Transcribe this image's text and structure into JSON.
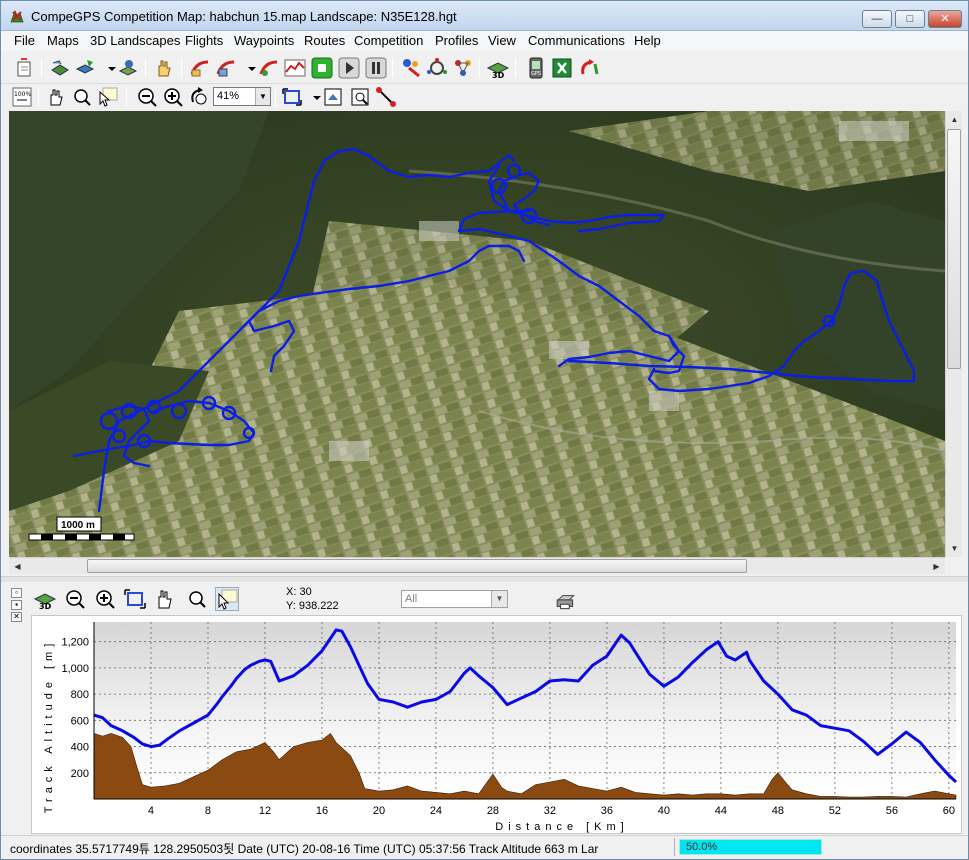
{
  "window": {
    "title": "CompeGPS Competition Map: habchun 15.map Landscape: N35E128.hgt",
    "buttons": {
      "minimize": "—",
      "maximize": "□",
      "close": "✕"
    }
  },
  "menu": [
    {
      "label": "File"
    },
    {
      "label": "Maps"
    },
    {
      "label": "3D Landscapes"
    },
    {
      "label": "Flights"
    },
    {
      "label": "Waypoints"
    },
    {
      "label": "Routes"
    },
    {
      "label": "Competition"
    },
    {
      "label": "Profiles"
    },
    {
      "label": "View"
    },
    {
      "label": "Communications"
    },
    {
      "label": "Help"
    }
  ],
  "toolbar2": {
    "zoom_value": "41%",
    "zoom_icon_label": "100%"
  },
  "map": {
    "scale_label": "1000 m",
    "track_color": "#0a1ee6"
  },
  "profile": {
    "cursor_x": "X: 30",
    "cursor_y": "Y: 938.222",
    "layer_filter": "All",
    "panel_controls": {
      "restore": "▫",
      "menu": "▪",
      "close": "✕"
    }
  },
  "chart_data": {
    "type": "area",
    "xlabel": "Distance [Km]",
    "ylabel": "Track Altitude [m]",
    "x_ticks": [
      4,
      8,
      12,
      16,
      20,
      24,
      28,
      32,
      36,
      40,
      44,
      48,
      52,
      56,
      60
    ],
    "y_ticks": [
      200,
      400,
      600,
      800,
      "1,000",
      "1,200"
    ],
    "xlim": [
      0,
      60.5
    ],
    "ylim": [
      0,
      1350
    ],
    "grid": true,
    "series": [
      {
        "kind": "line",
        "color": "#0a0ae6",
        "points": [
          [
            0,
            640
          ],
          [
            0.6,
            620
          ],
          [
            1.2,
            560
          ],
          [
            2,
            520
          ],
          [
            2.8,
            470
          ],
          [
            3.4,
            420
          ],
          [
            4,
            400
          ],
          [
            4.6,
            410
          ],
          [
            5.2,
            460
          ],
          [
            6,
            520
          ],
          [
            7,
            580
          ],
          [
            8,
            640
          ],
          [
            8.6,
            720
          ],
          [
            9,
            780
          ],
          [
            9.6,
            860
          ],
          [
            10,
            920
          ],
          [
            10.6,
            990
          ],
          [
            11,
            1020
          ],
          [
            11.6,
            1050
          ],
          [
            12,
            1060
          ],
          [
            12.4,
            1050
          ],
          [
            13,
            900
          ],
          [
            14,
            940
          ],
          [
            15,
            1020
          ],
          [
            16,
            1130
          ],
          [
            16.5,
            1210
          ],
          [
            17,
            1290
          ],
          [
            17.4,
            1280
          ],
          [
            18,
            1160
          ],
          [
            18.6,
            1020
          ],
          [
            19.2,
            880
          ],
          [
            20,
            760
          ],
          [
            21,
            740
          ],
          [
            22,
            700
          ],
          [
            23,
            740
          ],
          [
            24,
            760
          ],
          [
            25,
            820
          ],
          [
            26,
            960
          ],
          [
            26.4,
            1000
          ],
          [
            27,
            940
          ],
          [
            28,
            850
          ],
          [
            29,
            720
          ],
          [
            30,
            770
          ],
          [
            31,
            820
          ],
          [
            32,
            900
          ],
          [
            33,
            910
          ],
          [
            34,
            900
          ],
          [
            35,
            1020
          ],
          [
            36,
            1090
          ],
          [
            37,
            1250
          ],
          [
            37.6,
            1190
          ],
          [
            38,
            1120
          ],
          [
            39,
            950
          ],
          [
            40,
            860
          ],
          [
            41,
            930
          ],
          [
            42,
            1040
          ],
          [
            43,
            1140
          ],
          [
            43.8,
            1200
          ],
          [
            44.4,
            1090
          ],
          [
            45,
            1060
          ],
          [
            45.8,
            1120
          ],
          [
            46,
            1060
          ],
          [
            47,
            900
          ],
          [
            48,
            800
          ],
          [
            49,
            680
          ],
          [
            50,
            640
          ],
          [
            51,
            560
          ],
          [
            52,
            540
          ],
          [
            53,
            520
          ],
          [
            54,
            440
          ],
          [
            55,
            340
          ],
          [
            56,
            420
          ],
          [
            57,
            510
          ],
          [
            58,
            430
          ],
          [
            59,
            300
          ],
          [
            60,
            180
          ],
          [
            60.5,
            130
          ]
        ]
      },
      {
        "kind": "area",
        "color": "#8b4a12",
        "points": [
          [
            0,
            500
          ],
          [
            0.6,
            480
          ],
          [
            1.2,
            500
          ],
          [
            2,
            470
          ],
          [
            2.6,
            400
          ],
          [
            3,
            250
          ],
          [
            3.4,
            110
          ],
          [
            4,
            90
          ],
          [
            5,
            100
          ],
          [
            6,
            120
          ],
          [
            7,
            170
          ],
          [
            8,
            220
          ],
          [
            9,
            300
          ],
          [
            10,
            360
          ],
          [
            11,
            380
          ],
          [
            12,
            430
          ],
          [
            12.6,
            360
          ],
          [
            13,
            300
          ],
          [
            14,
            400
          ],
          [
            15,
            430
          ],
          [
            16,
            450
          ],
          [
            16.6,
            500
          ],
          [
            17,
            430
          ],
          [
            18,
            330
          ],
          [
            18.6,
            200
          ],
          [
            19,
            80
          ],
          [
            20,
            60
          ],
          [
            21,
            70
          ],
          [
            22,
            100
          ],
          [
            23,
            60
          ],
          [
            24,
            50
          ],
          [
            25,
            40
          ],
          [
            26,
            60
          ],
          [
            27,
            40
          ],
          [
            28,
            190
          ],
          [
            28.6,
            90
          ],
          [
            29,
            60
          ],
          [
            30,
            40
          ],
          [
            31,
            110
          ],
          [
            32,
            130
          ],
          [
            33,
            150
          ],
          [
            34,
            100
          ],
          [
            35,
            80
          ],
          [
            36,
            60
          ],
          [
            37,
            90
          ],
          [
            38,
            50
          ],
          [
            39,
            40
          ],
          [
            40,
            30
          ],
          [
            41,
            40
          ],
          [
            42,
            30
          ],
          [
            43,
            40
          ],
          [
            44,
            40
          ],
          [
            45,
            30
          ],
          [
            46,
            40
          ],
          [
            47,
            40
          ],
          [
            47.6,
            150
          ],
          [
            48,
            200
          ],
          [
            48.6,
            120
          ],
          [
            49,
            70
          ],
          [
            50,
            40
          ],
          [
            51,
            20
          ],
          [
            52,
            20
          ],
          [
            53,
            15
          ],
          [
            54,
            15
          ],
          [
            55,
            20
          ],
          [
            56,
            20
          ],
          [
            57,
            15
          ],
          [
            58,
            40
          ],
          [
            59,
            60
          ],
          [
            60,
            40
          ],
          [
            60.5,
            30
          ]
        ]
      }
    ]
  },
  "statusbar": {
    "text": "coordinates 35.5717749튜 128.2950503됫 Date (UTC) 20-08-16 Time (UTC) 05:37:56 Track Altitude 663 m Lar",
    "progress_value": 0.5,
    "progress_label": "50.0%"
  }
}
